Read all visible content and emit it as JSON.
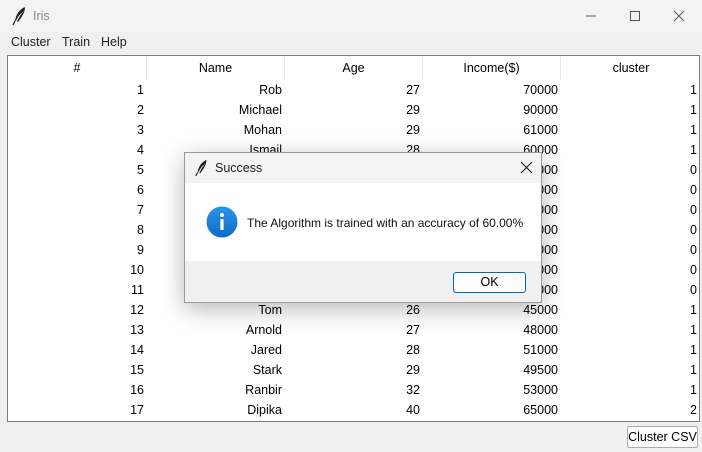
{
  "window": {
    "title": "Iris",
    "app_icon": "feather-icon"
  },
  "menu": [
    "Cluster",
    "Train",
    "Help"
  ],
  "table": {
    "columns": [
      "#",
      "Name",
      "Age",
      "Income($)",
      "cluster"
    ],
    "rows": [
      [
        "1",
        "Rob",
        "27",
        "70000",
        "1"
      ],
      [
        "2",
        "Michael",
        "29",
        "90000",
        "1"
      ],
      [
        "3",
        "Mohan",
        "29",
        "61000",
        "1"
      ],
      [
        "4",
        "Ismail",
        "28",
        "60000",
        "1"
      ],
      [
        "5",
        "",
        "",
        "000",
        "0"
      ],
      [
        "6",
        "",
        "",
        "000",
        "0"
      ],
      [
        "7",
        "",
        "",
        "000",
        "0"
      ],
      [
        "8",
        "",
        "",
        "000",
        "0"
      ],
      [
        "9",
        "",
        "",
        "000",
        "0"
      ],
      [
        "10",
        "",
        "",
        "000",
        "0"
      ],
      [
        "11",
        "",
        "",
        "000",
        "0"
      ],
      [
        "12",
        "Tom",
        "26",
        "45000",
        "1"
      ],
      [
        "13",
        "Arnold",
        "27",
        "48000",
        "1"
      ],
      [
        "14",
        "Jared",
        "28",
        "51000",
        "1"
      ],
      [
        "15",
        "Stark",
        "29",
        "49500",
        "1"
      ],
      [
        "16",
        "Ranbir",
        "32",
        "53000",
        "1"
      ],
      [
        "17",
        "Dipika",
        "40",
        "65000",
        "2"
      ]
    ]
  },
  "cluster_csv_button": "Cluster CSV",
  "dialog": {
    "title": "Success",
    "message": "The Algorithm is trained with an accuracy of 60.00%",
    "ok_label": "OK",
    "icon": "info-icon"
  },
  "colors": {
    "info_blue": "#1a7fd4",
    "ok_border": "#0067c0"
  }
}
